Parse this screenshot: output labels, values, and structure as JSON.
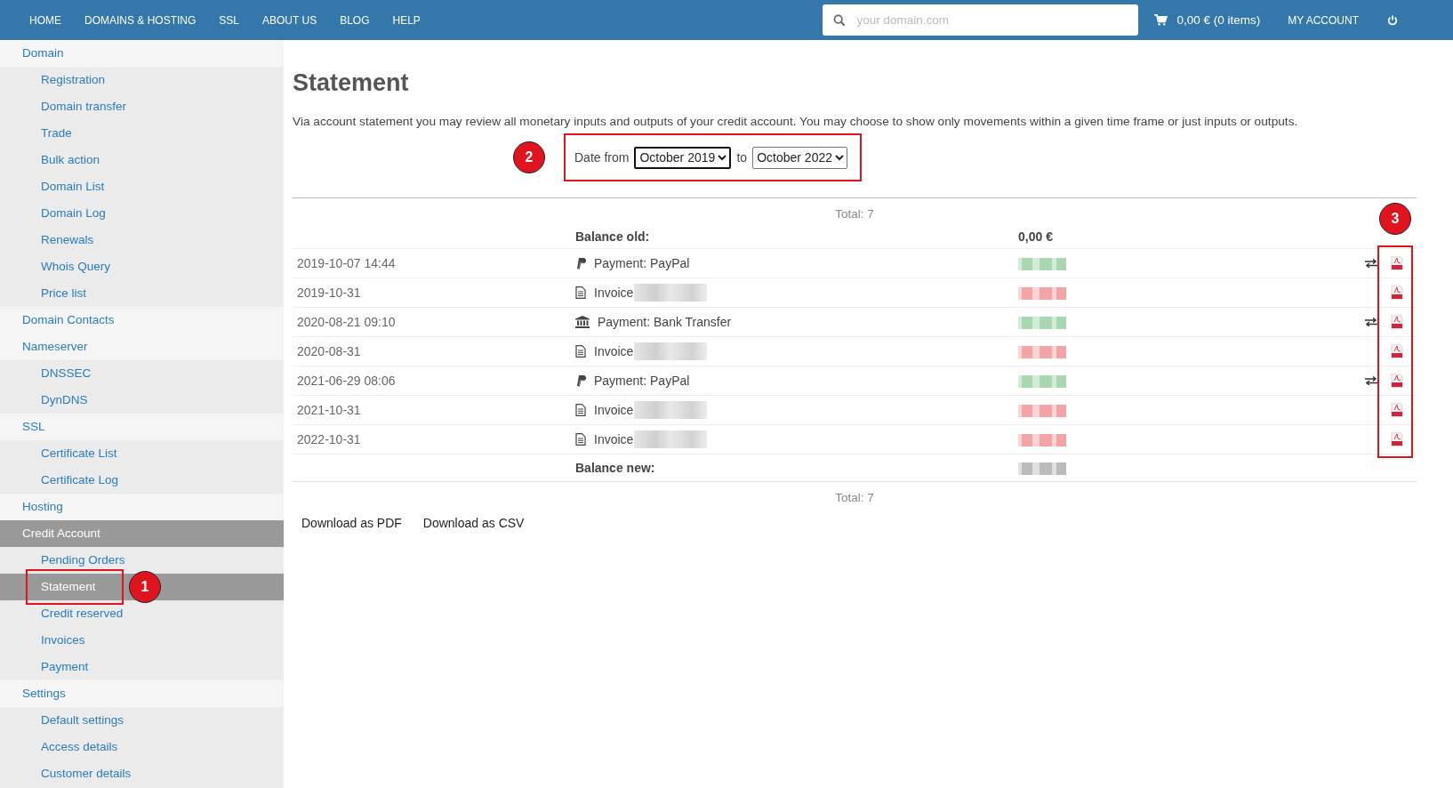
{
  "nav": {
    "items": [
      {
        "label": "HOME"
      },
      {
        "label": "DOMAINS & HOSTING"
      },
      {
        "label": "SSL"
      },
      {
        "label": "ABOUT US"
      },
      {
        "label": "BLOG"
      },
      {
        "label": "HELP"
      }
    ],
    "search": {
      "placeholder": "your domain.com"
    },
    "cart": "0,00 € (0 items)",
    "account": "MY ACCOUNT"
  },
  "sidebar": {
    "items": [
      {
        "label": "Domain",
        "selected": false,
        "children": [
          {
            "label": "Registration",
            "selected": false
          },
          {
            "label": "Domain transfer",
            "selected": false
          },
          {
            "label": "Trade",
            "selected": false
          },
          {
            "label": "Bulk action",
            "selected": false
          },
          {
            "label": "Domain List",
            "selected": false
          },
          {
            "label": "Domain Log",
            "selected": false
          },
          {
            "label": "Renewals",
            "selected": false
          },
          {
            "label": "Whois Query",
            "selected": false
          },
          {
            "label": "Price list",
            "selected": false
          }
        ]
      },
      {
        "label": "Domain Contacts",
        "selected": false
      },
      {
        "label": "Nameserver",
        "selected": false,
        "children": [
          {
            "label": "DNSSEC",
            "selected": false
          },
          {
            "label": "DynDNS",
            "selected": false
          }
        ]
      },
      {
        "label": "SSL",
        "selected": false,
        "children": [
          {
            "label": "Certificate List",
            "selected": false
          },
          {
            "label": "Certificate Log",
            "selected": false
          }
        ]
      },
      {
        "label": "Hosting",
        "selected": false
      },
      {
        "label": "Credit Account",
        "selected": true,
        "children": [
          {
            "label": "Pending Orders",
            "selected": false
          },
          {
            "label": "Statement",
            "selected": true,
            "callout": "1"
          },
          {
            "label": "Credit reserved",
            "selected": false
          },
          {
            "label": "Invoices",
            "selected": false
          },
          {
            "label": "Payment",
            "selected": false
          }
        ]
      },
      {
        "label": "Settings",
        "selected": false,
        "children": [
          {
            "label": "Default settings",
            "selected": false
          },
          {
            "label": "Access details",
            "selected": false
          },
          {
            "label": "Customer details",
            "selected": false
          }
        ]
      }
    ]
  },
  "page": {
    "title": "Statement",
    "intro": "Via account statement you may review all monetary inputs and outputs of your credit account. You may choose to show only movements within a given time frame or just inputs or outputs.",
    "date_filter": {
      "callout": "2",
      "label": "Date from",
      "from": "October 2019",
      "separator": "to",
      "to": "October 2022"
    },
    "total_top": "Total: 7",
    "balance_old": {
      "label": "Balance old:",
      "amount": "0,00 €"
    },
    "table": {
      "callout": "3",
      "rows": [
        {
          "date": "2019-10-07 14:44",
          "kind": "paypal",
          "description": "Payment: PayPal",
          "transfer": true
        },
        {
          "date": "2019-10-31",
          "kind": "invoice",
          "description": "Invoice",
          "transfer": false
        },
        {
          "date": "2020-08-21 09:10",
          "kind": "bank",
          "description": "Payment: Bank Transfer",
          "transfer": true
        },
        {
          "date": "2020-08-31",
          "kind": "invoice",
          "description": "Invoice",
          "transfer": false
        },
        {
          "date": "2021-06-29 08:06",
          "kind": "paypal",
          "description": "Payment: PayPal",
          "transfer": true
        },
        {
          "date": "2021-10-31",
          "kind": "invoice",
          "description": "Invoice",
          "transfer": false
        },
        {
          "date": "2022-10-31",
          "kind": "invoice",
          "description": "Invoice",
          "transfer": false
        }
      ]
    },
    "balance_new": {
      "label": "Balance new:"
    },
    "total_bottom": "Total: 7",
    "downloads": [
      {
        "label": "Download as PDF"
      },
      {
        "label": "Download as CSV"
      }
    ]
  }
}
